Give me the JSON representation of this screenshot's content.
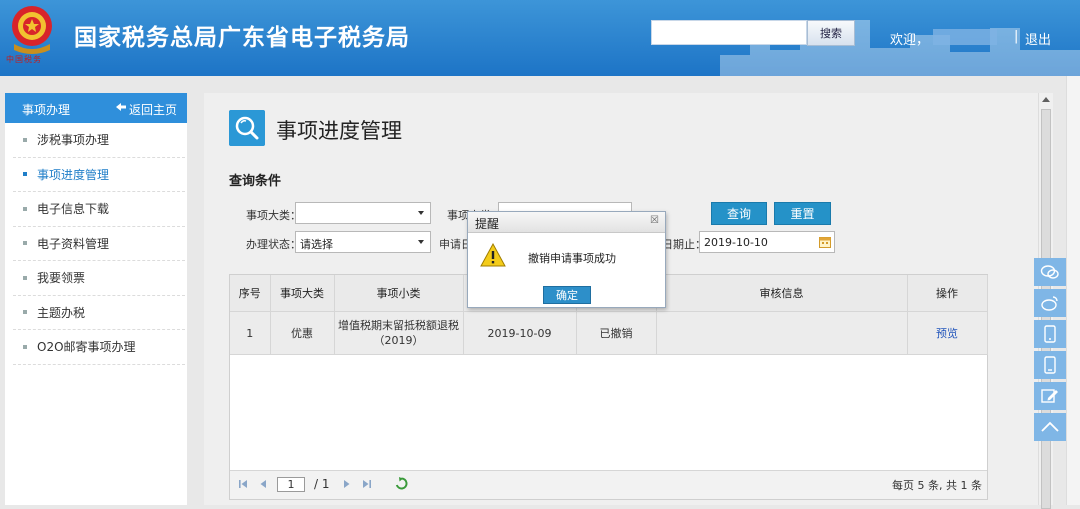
{
  "header": {
    "emblem_caption": "中国税务",
    "title": "国家税务总局广东省电子税务局",
    "search_value": "",
    "search_button": "搜索",
    "welcome": "欢迎，",
    "separator": "|",
    "logout": "退出"
  },
  "sidebar": {
    "title": "事项办理",
    "home_link": "返回主页",
    "items": [
      {
        "label": "涉税事项办理"
      },
      {
        "label": "事项进度管理"
      },
      {
        "label": "电子信息下载"
      },
      {
        "label": "电子资料管理"
      },
      {
        "label": "我要领票"
      },
      {
        "label": "主题办税"
      },
      {
        "label": "O2O邮寄事项办理"
      }
    ],
    "active_index": 1
  },
  "main": {
    "page_title": "事项进度管理",
    "section_title": "查询条件",
    "filters": {
      "category_label": "事项大类：",
      "category_value": "",
      "subcategory_label": "事项小类",
      "status_label": "办理状态：",
      "status_value": "请选择",
      "apply_date_label": "申请日",
      "end_date_label": "日期止：",
      "end_date_value": "2019-10-10"
    },
    "buttons": {
      "query": "查询",
      "reset": "重置"
    },
    "table": {
      "columns": [
        "序号",
        "事项大类",
        "事项小类",
        "",
        "",
        "审核信息",
        "操作"
      ],
      "rows": [
        {
          "index": "1",
          "category": "优惠",
          "subcategory_line1": "增值税期末留抵税额退税",
          "subcategory_line2": "（2019）",
          "date": "2019-10-09",
          "status": "已撤销",
          "review": "",
          "action": "预览"
        }
      ]
    },
    "pager": {
      "page": "1",
      "total": "/ 1",
      "info": "每页 5 条, 共 1 条"
    }
  },
  "dialog": {
    "title": "提醒",
    "close": "☒",
    "message": "撤销申请事项成功",
    "ok": "确定"
  },
  "colors": {
    "header_blue": "#1d74c6",
    "sidebar_head": "#2f8fdb",
    "accent": "#2592c8",
    "active_text": "#1f7ec8"
  }
}
